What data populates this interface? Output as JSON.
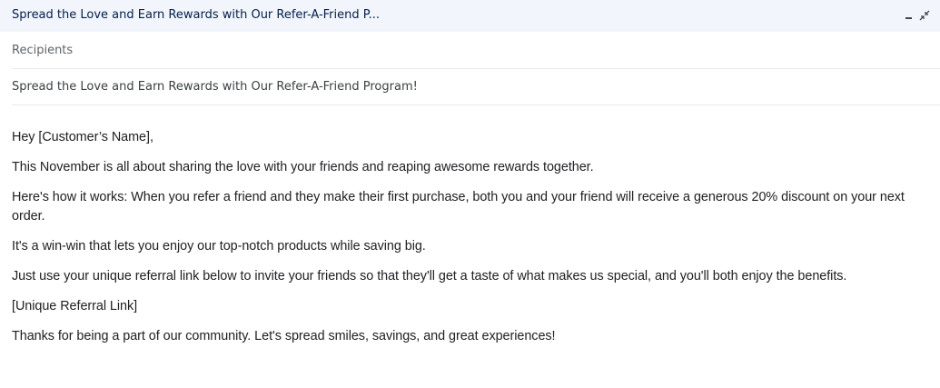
{
  "compose": {
    "header_title": "Spread the Love and Earn Rewards with Our Refer-A-Friend P...",
    "minimize_icon": "minimize-icon",
    "exit_fullscreen_icon": "exit-fullscreen-icon",
    "recipients_placeholder": "Recipients",
    "subject": "Spread the Love and Earn Rewards with Our Refer-A-Friend Program!",
    "body": [
      "Hey [Customer’s Name],",
      "This November is all about sharing the love with your friends and reaping awesome rewards together.",
      "Here's how it works: When you refer a friend and they make their first purchase, both you and your friend will receive a generous 20% discount on your next order.",
      "It's a win-win that lets you enjoy our top-notch products while saving big.",
      "Just use your unique referral link below to invite your friends so that they'll get a taste of what makes us special, and you'll both enjoy the benefits.",
      "[Unique Referral Link]",
      "Thanks for being a part of our community. Let's spread smiles, savings, and great experiences!"
    ]
  },
  "colors": {
    "header_bg": "#f2f6fc",
    "header_text": "#041e49",
    "divider": "#e8eaed"
  }
}
